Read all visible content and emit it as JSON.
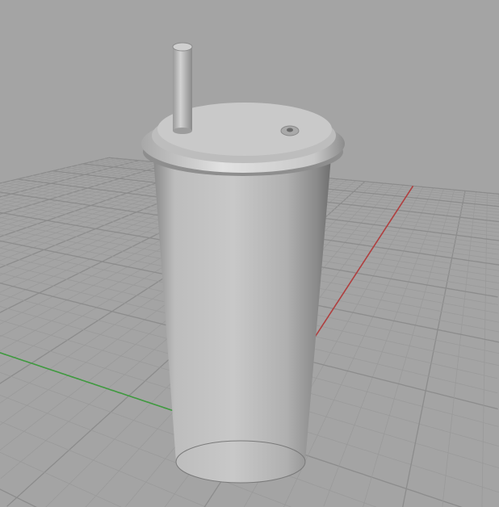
{
  "viewport": {
    "background": "#a4a4a4",
    "grid": {
      "plane_color": "#a9a9a9",
      "minor_line_color": "#9a9a9a",
      "major_line_color": "#8c8c8c",
      "x_axis_color": "#3f9a3f",
      "y_axis_color": "#b04040"
    },
    "object": {
      "name": "cup-with-lid-and-straw",
      "shade_light": "#d6d6d6",
      "shade_dark": "#6e6e6e"
    }
  }
}
